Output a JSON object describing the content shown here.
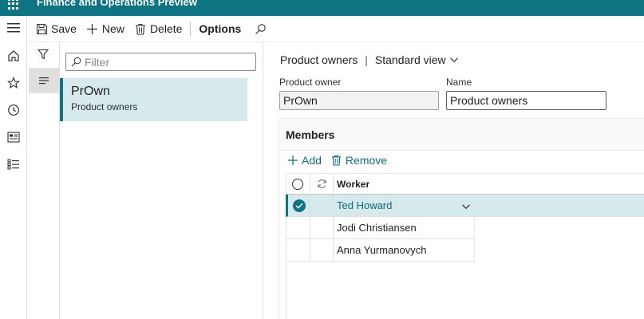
{
  "app": {
    "title": "Finance and Operations Preview"
  },
  "nav": {
    "icons": [
      "home-icon",
      "star-icon",
      "clock-icon",
      "workspace-icon",
      "list-icon"
    ]
  },
  "toolbar": {
    "save_label": "Save",
    "new_label": "New",
    "delete_label": "Delete",
    "options_label": "Options"
  },
  "list": {
    "filter_placeholder": "Filter",
    "items": [
      {
        "title": "PrOwn",
        "subtitle": "Product owners"
      }
    ]
  },
  "detail": {
    "breadcrumb": "Product owners",
    "view": "Standard view",
    "fields": {
      "product_owner_label": "Product owner",
      "product_owner_value": "PrOwn",
      "name_label": "Name",
      "name_value": "Product owners"
    },
    "members": {
      "title": "Members",
      "add_label": "Add",
      "remove_label": "Remove",
      "column_worker": "Worker",
      "rows": [
        {
          "worker": "Ted Howard",
          "selected": true
        },
        {
          "worker": "Jodi Christiansen",
          "selected": false
        },
        {
          "worker": "Anna Yurmanovych",
          "selected": false
        }
      ]
    }
  },
  "colors": {
    "brand": "#0e7481",
    "selected_row": "#d6e9ec",
    "link": "#0e6a77"
  }
}
